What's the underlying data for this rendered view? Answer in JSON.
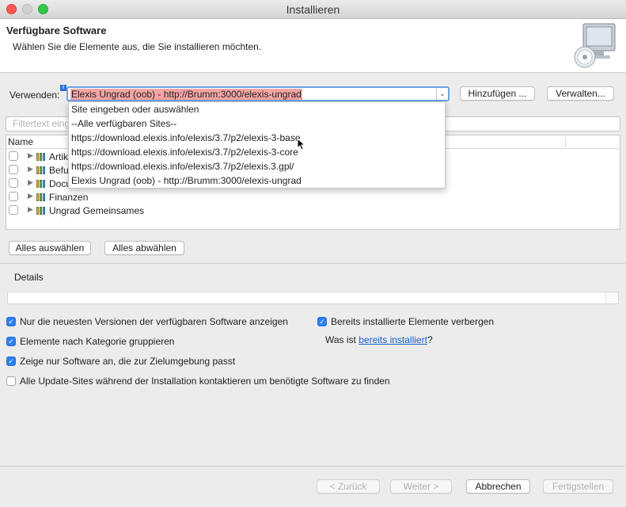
{
  "window": {
    "title": "Installieren"
  },
  "header": {
    "title": "Verfügbare Software",
    "description": "Wählen Sie die Elemente aus, die Sie installieren möchten.",
    "icon": "monitor-cd-icon"
  },
  "site": {
    "label": "Verwenden:",
    "info_marker": "i",
    "value": "Elexis Ungrad  (oob) - http://Brumm:3000/elexis-ungrad",
    "add_button": "Hinzufügen ...",
    "manage_button": "Verwalten..."
  },
  "dropdown": {
    "items": [
      "Site eingeben oder auswählen",
      "--Alle verfügbaren Sites--",
      "https://download.elexis.info/elexis/3.7/p2/elexis-3-base",
      "https://download.elexis.info/elexis/3.7/p2/elexis-3-core",
      "https://download.elexis.info/elexis/3.7/p2/elexis.3.gpl/",
      "Elexis Ungrad  (oob) - http://Brumm:3000/elexis-ungrad"
    ]
  },
  "filter": {
    "placeholder": "Filtertext eing"
  },
  "tree": {
    "column_name": "Name",
    "rows": [
      {
        "label": "Artik"
      },
      {
        "label": "Befu"
      },
      {
        "label": "Docu"
      },
      {
        "label": "Finanzen"
      },
      {
        "label": "Ungrad Gemeinsames"
      }
    ]
  },
  "selection": {
    "select_all": "Alles auswählen",
    "deselect_all": "Alles abwählen"
  },
  "details": {
    "label": "Details"
  },
  "options": {
    "latest_only": {
      "label": "Nur die neuesten Versionen der verfügbaren Software anzeigen",
      "checked": true
    },
    "group_by_category": {
      "label": "Elemente nach Kategorie gruppieren",
      "checked": true
    },
    "target_env_only": {
      "label": "Zeige nur Software an, die zur Zielumgebung passt",
      "checked": true
    },
    "contact_all_sites": {
      "label": "Alle Update-Sites während der Installation kontaktieren um benötigte Software zu finden",
      "checked": false
    },
    "hide_installed": {
      "label": "Bereits installierte Elemente verbergen",
      "checked": true
    },
    "what_installed_prefix": "Was ist ",
    "what_installed_link": "bereits installiert",
    "what_installed_suffix": "?"
  },
  "footer": {
    "back": "< Zurück",
    "next": "Weiter >",
    "cancel": "Abbrechen",
    "finish": "Fertigstellen"
  },
  "colors": {
    "accent": "#2d7ff2",
    "selection_highlight": "#f5a5a5",
    "link": "#1a5fd0"
  }
}
